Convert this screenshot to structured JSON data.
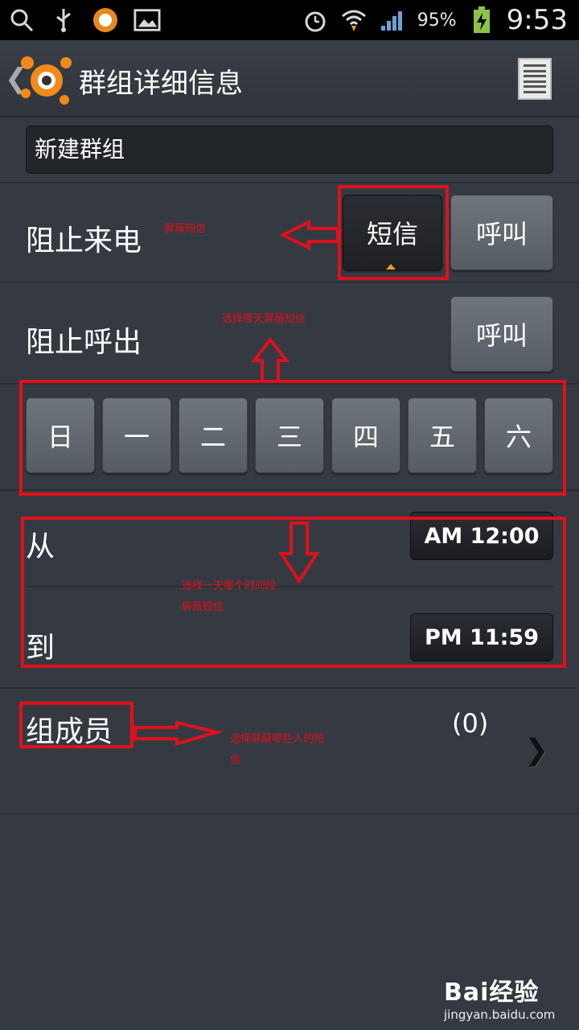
{
  "status_bar": {
    "battery": "95%",
    "time": "9:53"
  },
  "titlebar": {
    "back": "❮",
    "title": "群组详细信息"
  },
  "group_name": "新建群组",
  "block_incoming": {
    "label": "阻止来电",
    "sms_button": "短信",
    "call_button": "呼叫"
  },
  "block_outgoing": {
    "label": "阻止呼出",
    "call_button": "呼叫"
  },
  "days": [
    "日",
    "一",
    "二",
    "三",
    "四",
    "五",
    "六"
  ],
  "time_range": {
    "from_label": "从",
    "from_value": "AM 12:00",
    "to_label": "到",
    "to_value": "PM 11:59"
  },
  "members": {
    "label": "组成员",
    "count": "(0)"
  },
  "annotations": {
    "sms": "屏蔽短信",
    "days": "选择哪天屏蔽短信",
    "time_line1": "选择一天哪个时间段",
    "time_line2": "屏蔽短信",
    "members_line1": "选择屏蔽哪些人的短",
    "members_line2": "信"
  },
  "watermark": {
    "brand": "Bai经验",
    "url": "jingyan.baidu.com"
  },
  "colors": {
    "annotation_red": "#e0101a",
    "background": "#353a42",
    "accent_orange": "#e6a11b"
  }
}
